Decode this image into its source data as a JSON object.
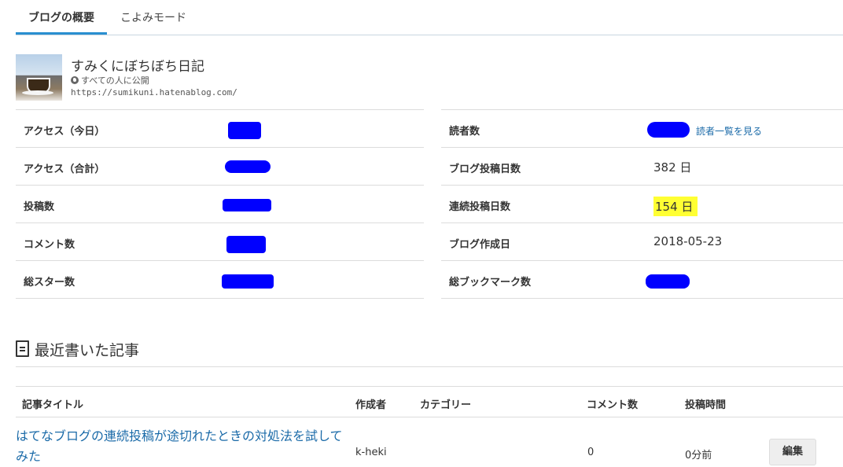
{
  "tabs": {
    "overview": "ブログの概要",
    "calendar": "こよみモード"
  },
  "blog": {
    "title": "すみくにぼちぼち日記",
    "visibility": "すべての人に公開",
    "url": "https://sumikuni.hatenablog.com/"
  },
  "stats_left": [
    {
      "label": "アクセス（今日）",
      "value": ""
    },
    {
      "label": "アクセス（合計）",
      "value": ""
    },
    {
      "label": "投稿数",
      "value": ""
    },
    {
      "label": "コメント数",
      "value": ""
    },
    {
      "label": "総スター数",
      "value": ""
    }
  ],
  "stats_right": [
    {
      "label": "読者数",
      "value": "",
      "link": "読者一覧を見る"
    },
    {
      "label": "ブログ投稿日数",
      "value": "382 日"
    },
    {
      "label": "連続投稿日数",
      "value": "154 日"
    },
    {
      "label": "ブログ作成日",
      "value": "2018-05-23"
    },
    {
      "label": "総ブックマーク数",
      "value": ""
    }
  ],
  "recent": {
    "title": "最近書いた記事",
    "headers": {
      "title": "記事タイトル",
      "author": "作成者",
      "category": "カテゴリー",
      "comments": "コメント数",
      "time": "投稿時間"
    },
    "rows": [
      {
        "title": "はてなブログの連続投稿が途切れたときの対処法を試してみた",
        "author": "k-heki",
        "category": "",
        "comments": "0",
        "time": "0分前",
        "edit": "編集"
      }
    ]
  },
  "colors": {
    "accent": "#2a8fd0",
    "link": "#1a6aa8",
    "highlight": "#ffff33",
    "redaction": "#0000ff"
  }
}
